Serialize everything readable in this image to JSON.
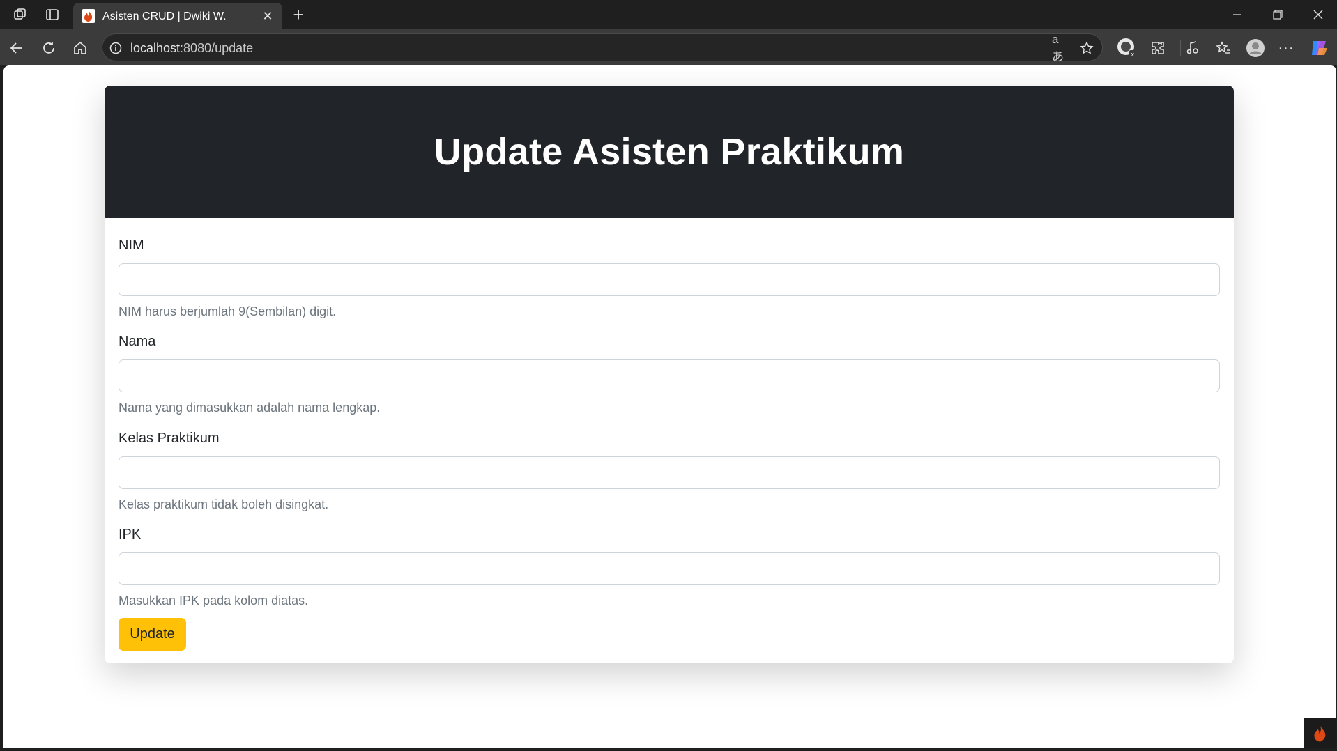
{
  "browser": {
    "tab_title": "Asisten CRUD | Dwiki W.",
    "url_host": "localhost",
    "url_path": ":8080/update"
  },
  "page": {
    "title": "Update Asisten Praktikum",
    "fields": [
      {
        "label": "NIM",
        "value": "",
        "help": "NIM harus berjumlah 9(Sembilan) digit."
      },
      {
        "label": "Nama",
        "value": "",
        "help": "Nama yang dimasukkan adalah nama lengkap."
      },
      {
        "label": "Kelas Praktikum",
        "value": "",
        "help": "Kelas praktikum tidak boleh disingkat."
      },
      {
        "label": "IPK",
        "value": "",
        "help": "Masukkan IPK pada kolom diatas."
      }
    ],
    "submit_label": "Update"
  },
  "colors": {
    "header_bg": "#212529",
    "button_bg": "#ffc107",
    "help_text": "#6c757d"
  },
  "icons": [
    "workspaces-icon",
    "vertical-tabs-icon",
    "codeigniter-flame-icon",
    "close-icon",
    "new-tab-icon",
    "minimize-icon",
    "restore-icon",
    "close-window-icon",
    "back-icon",
    "refresh-icon",
    "home-icon",
    "site-info-icon",
    "read-aloud-icon",
    "favorite-star-icon",
    "profile-extension-icon",
    "extensions-icon",
    "media-icon",
    "favorites-icon",
    "profile-icon",
    "more-icon",
    "copilot-icon"
  ]
}
